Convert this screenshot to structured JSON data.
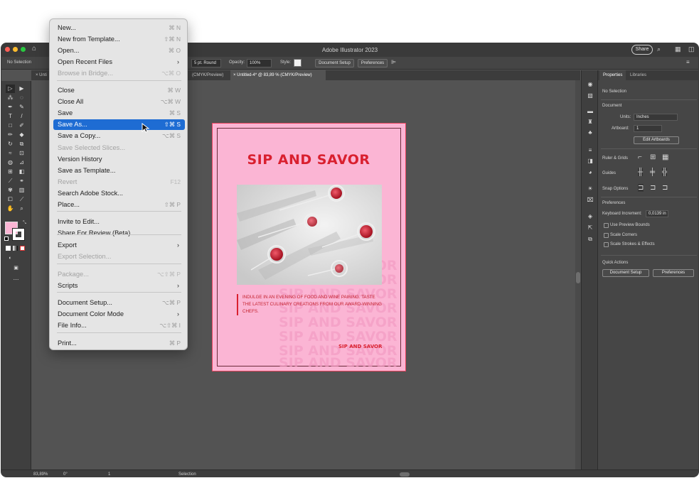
{
  "window": {
    "title": "Adobe Illustrator 2023",
    "share_label": "Share"
  },
  "control_bar": {
    "selection": "No Selection",
    "stroke_profile": "5 pt. Round",
    "opacity_label": "Opacity:",
    "opacity_value": "100%",
    "style_label": "Style:",
    "document_setup": "Document Setup",
    "preferences": "Preferences"
  },
  "tabs": [
    {
      "label": "Unti"
    },
    {
      "label": "(CMYK/Preview)"
    },
    {
      "label": "Untitled-4* @ 83,89 % (CMYK/Preview)"
    }
  ],
  "artboard": {
    "headline": "SIP AND SAVOR",
    "body": "INDULGE IN AN EVENING OF FOOD AND WINE PAIRING. TASTE THE LATEST CULINARY CREATIONS FROM OUR AWARD-WINNING CHEFS.",
    "footer": "SIP AND SAVOR",
    "ghost_text": "SIP AND SAVOR",
    "colors": {
      "background": "#fbb5d4",
      "accent": "#d9202f"
    }
  },
  "file_menu": {
    "items": [
      {
        "label": "New...",
        "shortcut": "⌘ N",
        "disabled": false
      },
      {
        "label": "New from Template...",
        "shortcut": "⇧⌘ N",
        "disabled": false
      },
      {
        "label": "Open...",
        "shortcut": "⌘ O",
        "disabled": false
      },
      {
        "label": "Open Recent Files",
        "shortcut": "",
        "submenu": true,
        "disabled": false
      },
      {
        "label": "Browse in Bridge...",
        "shortcut": "⌥⌘ O",
        "disabled": true
      },
      {
        "label": "Close",
        "shortcut": "⌘ W",
        "disabled": false
      },
      {
        "label": "Close All",
        "shortcut": "⌥⌘ W",
        "disabled": false
      },
      {
        "label": "Save",
        "shortcut": "⌘ S",
        "disabled": false
      },
      {
        "label": "Save As...",
        "shortcut": "⇧⌘ S",
        "disabled": false,
        "highlighted": true
      },
      {
        "label": "Save a Copy...",
        "shortcut": "⌥⌘ S",
        "disabled": false
      },
      {
        "label": "Save Selected Slices...",
        "shortcut": "",
        "disabled": true
      },
      {
        "label": "Version History",
        "shortcut": "",
        "disabled": false
      },
      {
        "label": "Save as Template...",
        "shortcut": "",
        "disabled": false
      },
      {
        "label": "Revert",
        "shortcut": "F12",
        "disabled": true
      },
      {
        "label": "Search Adobe Stock...",
        "shortcut": "",
        "disabled": false
      },
      {
        "label": "Place...",
        "shortcut": "⇧⌘ P",
        "disabled": false
      },
      {
        "label": "Invite to Edit...",
        "shortcut": "",
        "disabled": false
      },
      {
        "label": "Share For Review (Beta)...",
        "shortcut": "",
        "disabled": false
      },
      {
        "label": "Export",
        "shortcut": "",
        "submenu": true,
        "disabled": false
      },
      {
        "label": "Export Selection...",
        "shortcut": "",
        "disabled": true
      },
      {
        "label": "Package...",
        "shortcut": "⌥⇧⌘ P",
        "disabled": true
      },
      {
        "label": "Scripts",
        "shortcut": "",
        "submenu": true,
        "disabled": false
      },
      {
        "label": "Document Setup...",
        "shortcut": "⌥⌘ P",
        "disabled": false
      },
      {
        "label": "Document Color Mode",
        "shortcut": "",
        "submenu": true,
        "disabled": false
      },
      {
        "label": "File Info...",
        "shortcut": "⌥⇧⌘ I",
        "disabled": false
      },
      {
        "label": "Print...",
        "shortcut": "⌘ P",
        "disabled": false
      }
    ]
  },
  "properties_panel": {
    "tabs": [
      "Properties",
      "Libraries"
    ],
    "selection": "No Selection",
    "document_heading": "Document",
    "units_label": "Units:",
    "units_value": "Inches",
    "artboard_label": "Artboard:",
    "artboard_value": "1",
    "edit_artboards": "Edit Artboards",
    "ruler_grids": "Ruler & Grids",
    "guides": "Guides",
    "snap_options": "Snap Options",
    "preferences_heading": "Preferences",
    "keyboard_increment_label": "Keyboard Increment:",
    "keyboard_increment_value": "0,0139 in",
    "use_preview_bounds": "Use Preview Bounds",
    "scale_corners": "Scale Corners",
    "scale_strokes": "Scale Strokes & Effects",
    "quick_actions": "Quick Actions",
    "document_setup": "Document Setup",
    "preferences": "Preferences"
  },
  "status_bar": {
    "zoom": "83,89%",
    "rotation": "0°",
    "artboard_num": "1",
    "mode": "Selection"
  }
}
